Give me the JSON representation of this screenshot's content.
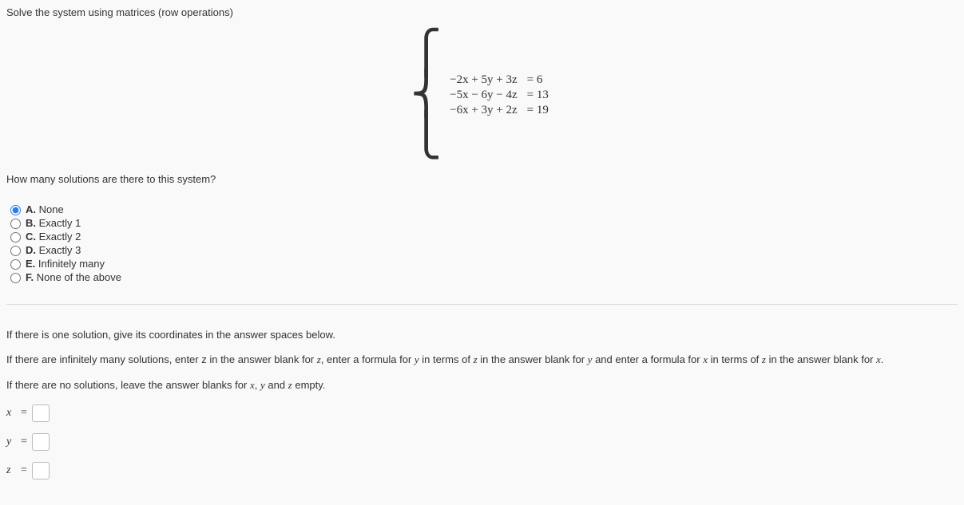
{
  "title": "Solve the system using matrices (row operations)",
  "equations": {
    "rows": [
      {
        "lhs": "−2x + 5y + 3z",
        "rhs": "= 6"
      },
      {
        "lhs": "−5x − 6y − 4z",
        "rhs": "= 13"
      },
      {
        "lhs": "−6x + 3y + 2z",
        "rhs": "= 19"
      }
    ]
  },
  "subquestion": "How many solutions are there to this system?",
  "options": [
    {
      "letter": "A.",
      "text": "None",
      "checked": true
    },
    {
      "letter": "B.",
      "text": "Exactly 1",
      "checked": false
    },
    {
      "letter": "C.",
      "text": "Exactly 2",
      "checked": false
    },
    {
      "letter": "D.",
      "text": "Exactly 3",
      "checked": false
    },
    {
      "letter": "E.",
      "text": "Infinitely many",
      "checked": false
    },
    {
      "letter": "F.",
      "text": "None of the above",
      "checked": false
    }
  ],
  "instructions": {
    "one_solution": "If there is one solution, give its coordinates in the answer spaces below.",
    "inf_many_pre": "If there are infinitely many solutions, enter z in the answer blank for ",
    "inf_many_z": "z",
    "inf_many_mid1": ", enter a formula for ",
    "inf_many_y": "y",
    "inf_many_mid2": " in terms of ",
    "inf_many_mid3": " in the answer blank for ",
    "inf_many_mid4": " and enter a formula for ",
    "inf_many_x": "x",
    "inf_many_end": ".",
    "no_solutions_pre": "If there are no solutions, leave the answer blanks for ",
    "no_solutions_mid1": ", ",
    "no_solutions_mid2": " and ",
    "no_solutions_end": " empty."
  },
  "answers": {
    "x_label": "x",
    "y_label": "y",
    "z_label": "z",
    "eq": "="
  }
}
